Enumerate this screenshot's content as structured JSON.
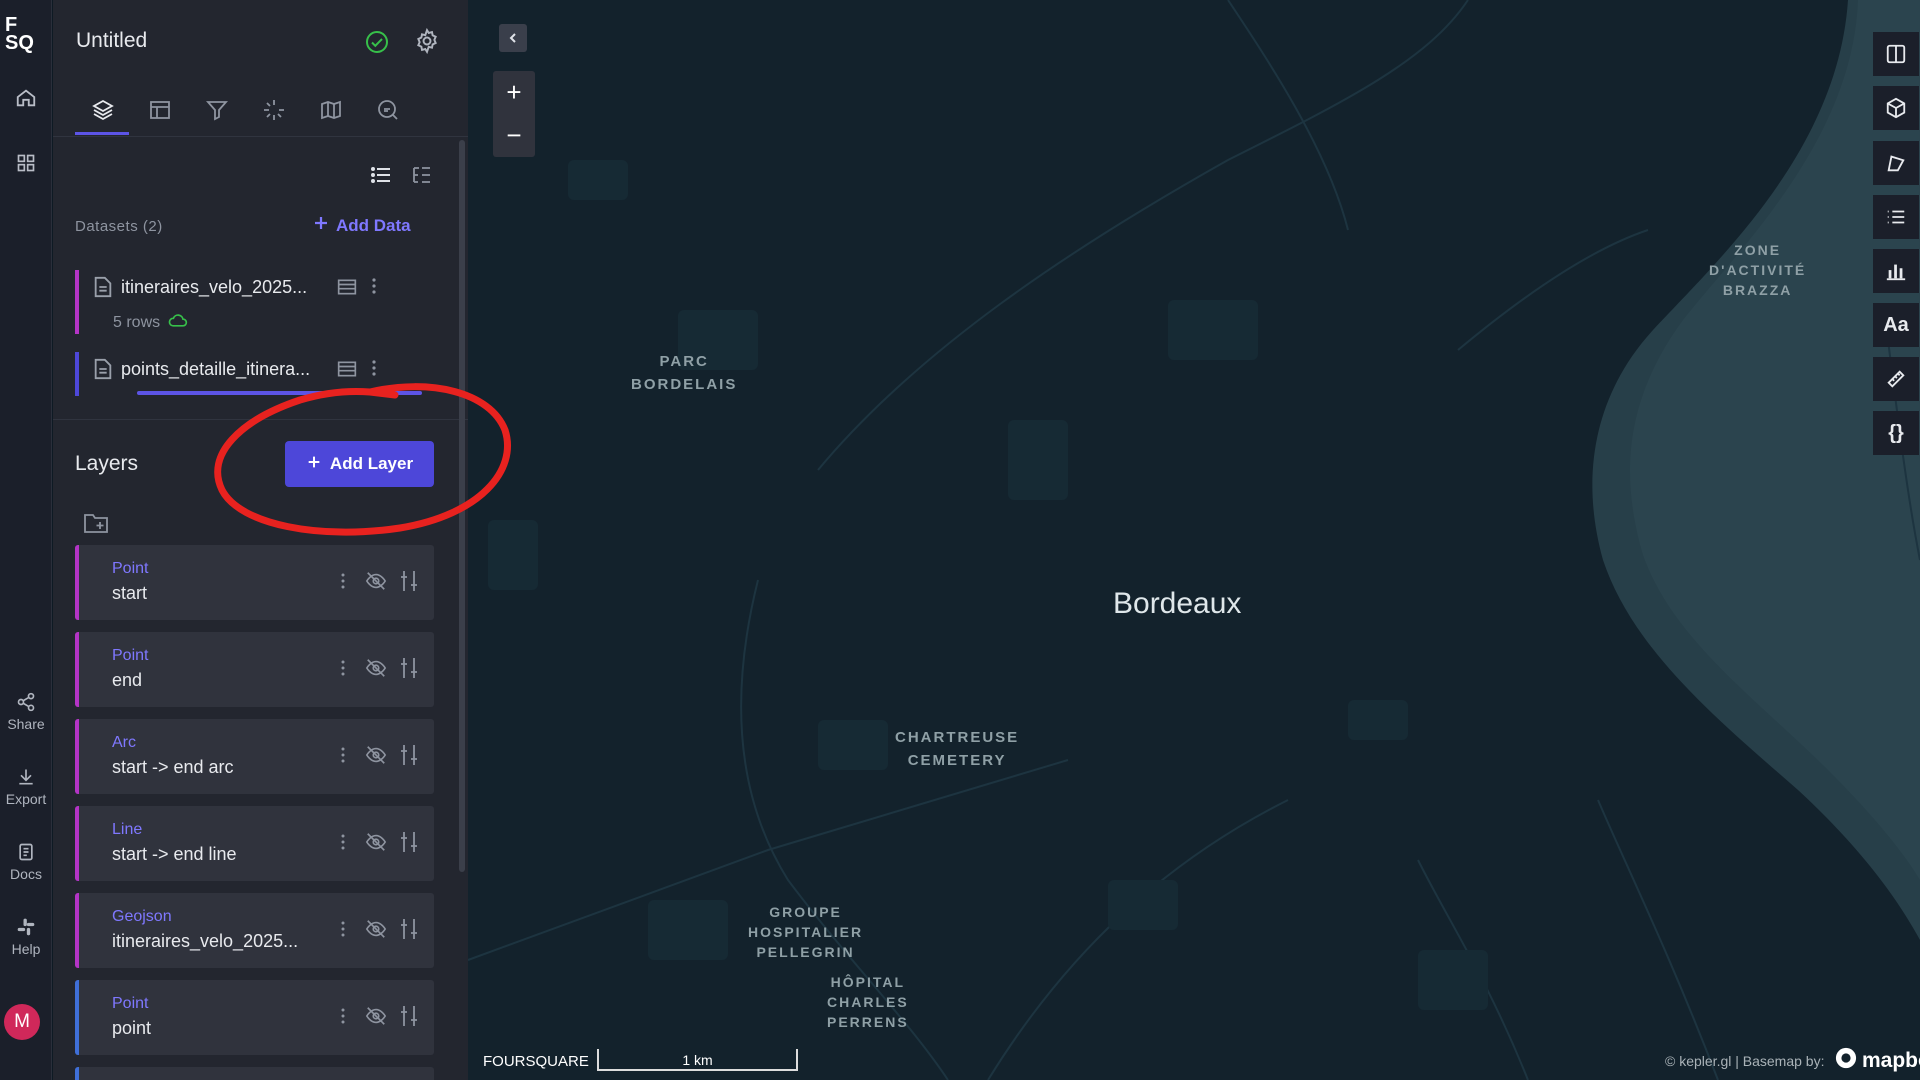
{
  "app": {
    "logo_line1": "F",
    "logo_line2": "SQ",
    "title": "Untitled"
  },
  "rail": {
    "share_label": "Share",
    "export_label": "Export",
    "docs_label": "Docs",
    "help_label": "Help",
    "avatar_initial": "M"
  },
  "datasets": {
    "label": "Datasets (2)",
    "add_label": "Add Data",
    "items": [
      {
        "name": "itineraires_velo_2025...",
        "rows": "5 rows",
        "color": "#b434c6"
      },
      {
        "name": "points_detaille_itinera...",
        "rows": "",
        "color": "#4d47d9"
      }
    ]
  },
  "layers": {
    "label": "Layers",
    "add_label": "Add Layer",
    "items": [
      {
        "type": "Point",
        "name": "start",
        "color": "#b434c6"
      },
      {
        "type": "Point",
        "name": "end",
        "color": "#b434c6"
      },
      {
        "type": "Arc",
        "name": "start -> end arc",
        "color": "#b434c6"
      },
      {
        "type": "Line",
        "name": "start -> end line",
        "color": "#b434c6"
      },
      {
        "type": "Geojson",
        "name": "itineraires_velo_2025...",
        "color": "#b434c6"
      },
      {
        "type": "Point",
        "name": "point",
        "color": "#3f6fd8"
      }
    ]
  },
  "map": {
    "city": "Bordeaux",
    "labels": {
      "parc": [
        "PARC",
        "BORDELAIS"
      ],
      "chartreuse": [
        "CHARTREUSE",
        "CEMETERY"
      ],
      "groupe": [
        "GROUPE",
        "HOSPITALIER",
        "PELLEGRIN"
      ],
      "hopital": [
        "HÔPITAL",
        "CHARLES",
        "PERRENS"
      ],
      "zone": [
        "ZONE",
        "D'ACTIVITÉ",
        "BRAZZA"
      ]
    },
    "foursquare": "FOURSQUARE",
    "scale_label": "1 km",
    "attribution": "© kepler.gl | Basemap by:",
    "mapbox": "mapbo",
    "zoom_in": "+",
    "zoom_out": "−"
  },
  "colors": {
    "accent": "#4d47d9",
    "annotation": "#e8221f",
    "ok": "#37c04a"
  }
}
